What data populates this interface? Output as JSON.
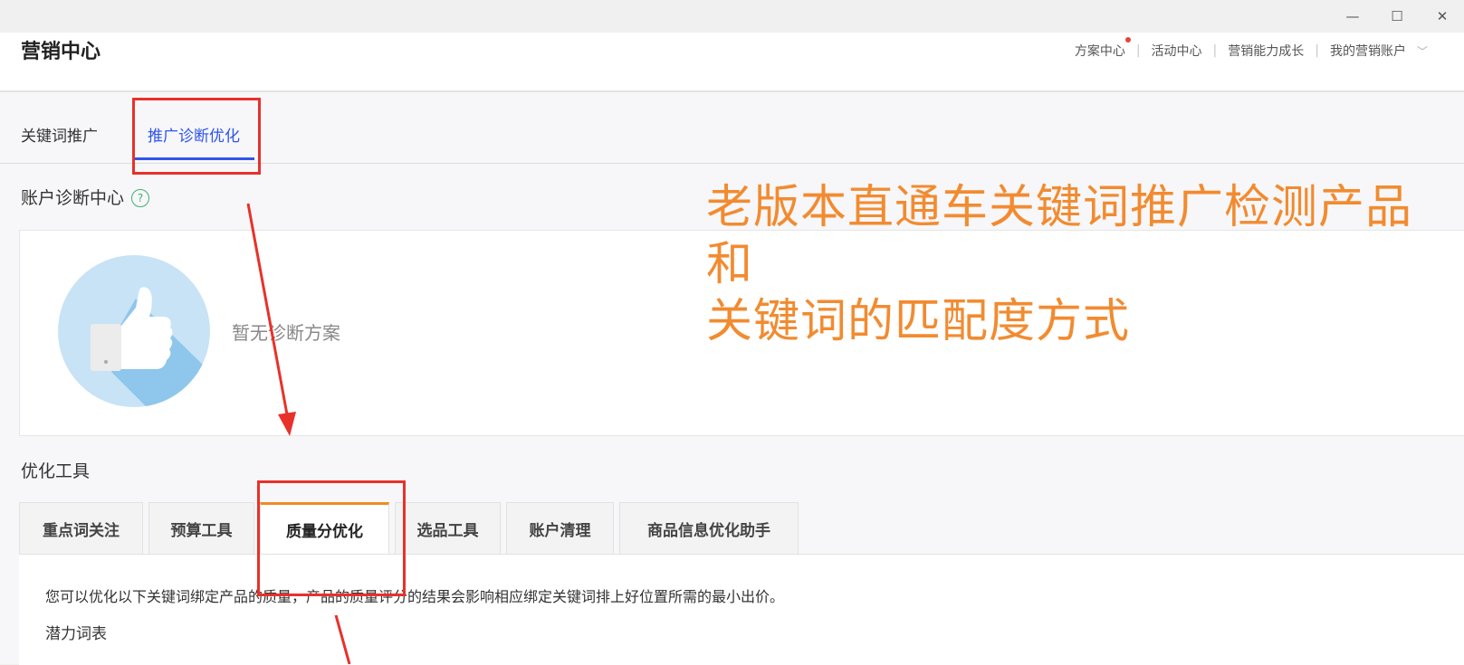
{
  "window": {
    "minimize": "—",
    "maximize": "☐",
    "close": "✕"
  },
  "header": {
    "brand": "营销中心",
    "nav": [
      "方案中心",
      "活动中心",
      "营销能力成长",
      "我的营销账户"
    ],
    "chevron": "﹀"
  },
  "tabs": [
    {
      "label": "关键词推广",
      "active": false
    },
    {
      "label": "推广诊断优化",
      "active": true
    }
  ],
  "diagnosis": {
    "title": "账户诊断中心",
    "help": "?",
    "empty": "暂无诊断方案"
  },
  "tools": {
    "title": "优化工具",
    "tabs": [
      {
        "label": "重点词关注",
        "active": false
      },
      {
        "label": "预算工具",
        "active": false
      },
      {
        "label": "质量分优化",
        "active": true
      },
      {
        "label": "选品工具",
        "active": false
      },
      {
        "label": "账户清理",
        "active": false
      },
      {
        "label": "商品信息优化助手",
        "active": false
      }
    ],
    "description": "您可以优化以下关键词绑定产品的质量，产品的质量评分的结果会影响相应绑定关键词排上好位置所需的最小出价。",
    "subheading": "潜力词表"
  },
  "annotation": {
    "line1": "老版本直通车关键词推广检测产品和",
    "line2": "关键词的匹配度方式"
  },
  "colors": {
    "accent": "#2f54eb",
    "annotation": "#f28b30",
    "highlight": "#e8312a",
    "tab_active_border": "#f08a24"
  }
}
